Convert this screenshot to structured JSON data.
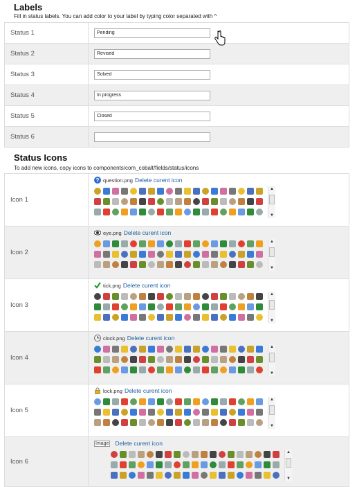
{
  "labels": {
    "title": "Labels",
    "hint": "Fill in status labels. You can add color to your label by typing color separated with ^",
    "rows": [
      {
        "label": "Status 1",
        "value": "Pending"
      },
      {
        "label": "Status 2",
        "value": "Revised"
      },
      {
        "label": "Status 3",
        "value": "Solved"
      },
      {
        "label": "Status 4",
        "value": "In progress"
      },
      {
        "label": "Status 5",
        "value": "Closed"
      },
      {
        "label": "Status 6",
        "value": ""
      }
    ]
  },
  "icons": {
    "title": "Status Icons",
    "hint": "To add new icons, copy icons to components/com_cobalt/fields/status/icons",
    "delete_label": "Delete curent icon",
    "rows": [
      {
        "label": "Icon 1",
        "file": "question.png",
        "icon": "question-icon"
      },
      {
        "label": "Icon 2",
        "file": "eye.png",
        "icon": "eye-icon"
      },
      {
        "label": "Icon 3",
        "file": "tick.png",
        "icon": "tick-icon"
      },
      {
        "label": "Icon 4",
        "file": "clock.png",
        "icon": "clock-icon"
      },
      {
        "label": "Icon 5",
        "file": "lock.png",
        "icon": "lock-icon"
      },
      {
        "label": "Icon 6",
        "file": "Image",
        "icon": "broken-image-icon"
      }
    ]
  },
  "colors": {
    "link": "#1a5d9f",
    "row_alt": "#efefef"
  }
}
